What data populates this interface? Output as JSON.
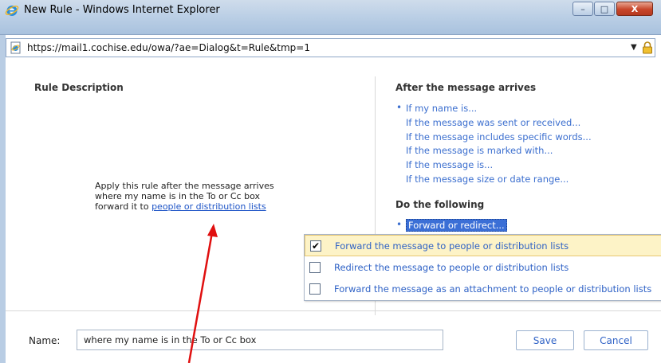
{
  "window": {
    "title": "New Rule - Windows Internet Explorer",
    "minimize_glyph": "–",
    "maximize_glyph": "□",
    "close_glyph": "X"
  },
  "address_bar": {
    "url": "https://mail1.cochise.edu/owa/?ae=Dialog&t=Rule&tmp=1",
    "dropdown_glyph": "▼"
  },
  "rule_description": {
    "heading": "Rule Description",
    "line1": "Apply this rule after the message arrives",
    "line2": "where my name is in the To or Cc box",
    "line3_prefix": "forward it to ",
    "line3_link": "people or distribution lists"
  },
  "conditions": {
    "heading": "After the message arrives",
    "items": [
      "If my name is...",
      "If the message was sent or received...",
      "If the message includes specific words...",
      "If the message is marked with...",
      "If the message is...",
      "If the message size or date range..."
    ]
  },
  "actions": {
    "heading": "Do the following",
    "selected": "Forward or redirect..."
  },
  "menu": {
    "items": [
      {
        "label": "Forward the message to people or distribution lists",
        "checked": true
      },
      {
        "label": "Redirect the message to people or distribution lists",
        "checked": false
      },
      {
        "label": "Forward the message as an attachment to people or distribution lists",
        "checked": false
      }
    ],
    "check_glyph": "✔"
  },
  "footer": {
    "name_label": "Name:",
    "name_value": "where my name is in the To or Cc box",
    "save_label": "Save",
    "cancel_label": "Cancel"
  },
  "colors": {
    "link": "#1c53c6",
    "annotation_arrow": "#e01010"
  }
}
